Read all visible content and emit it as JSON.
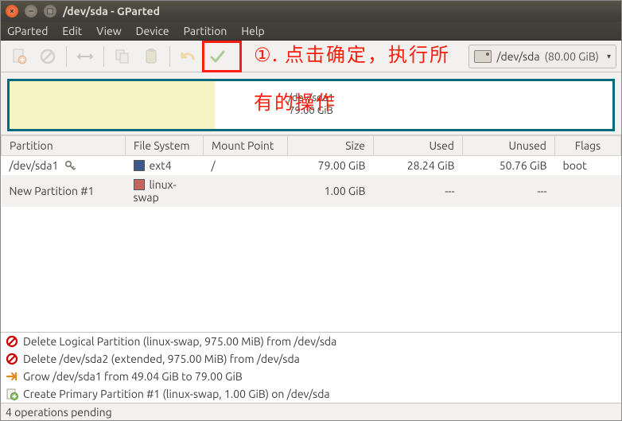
{
  "window": {
    "title": "/dev/sda - GParted"
  },
  "menu": {
    "gparted": "GParted",
    "edit": "Edit",
    "view": "View",
    "device": "Device",
    "partition": "Partition",
    "help": "Help"
  },
  "toolbar": {
    "device_label": "/dev/sda",
    "device_size": "(80.00 GiB)"
  },
  "annotation": {
    "line1": "①. 点击确定，执行所",
    "line2": "有的操作"
  },
  "visual": {
    "seg_main_name": "/dev/sda1",
    "seg_main_size": "79.00 GiB"
  },
  "columns": {
    "partition": "Partition",
    "filesystem": "File System",
    "mount": "Mount Point",
    "size": "Size",
    "used": "Used",
    "unused": "Unused",
    "flags": "Flags"
  },
  "rows": [
    {
      "partition": "/dev/sda1",
      "locked": true,
      "fs": "ext4",
      "swatch": "sw-ext4",
      "mount": "/",
      "size": "79.00 GiB",
      "used": "28.24 GiB",
      "unused": "50.76 GiB",
      "flags": "boot"
    },
    {
      "partition": "New Partition #1",
      "locked": false,
      "fs": "linux-swap",
      "swatch": "sw-swap",
      "mount": "",
      "size": "1.00 GiB",
      "used": "---",
      "unused": "---",
      "flags": ""
    }
  ],
  "ops": [
    {
      "icon": "forbid",
      "text": "Delete Logical Partition (linux-swap, 975.00 MiB) from /dev/sda"
    },
    {
      "icon": "forbid",
      "text": "Delete /dev/sda2 (extended, 975.00 MiB) from /dev/sda"
    },
    {
      "icon": "grow",
      "text": "Grow /dev/sda1 from 49.04 GiB to 79.00 GiB"
    },
    {
      "icon": "add",
      "text": "Create Primary Partition #1 (linux-swap, 1.00 GiB) on /dev/sda"
    }
  ],
  "status": "4 operations pending"
}
